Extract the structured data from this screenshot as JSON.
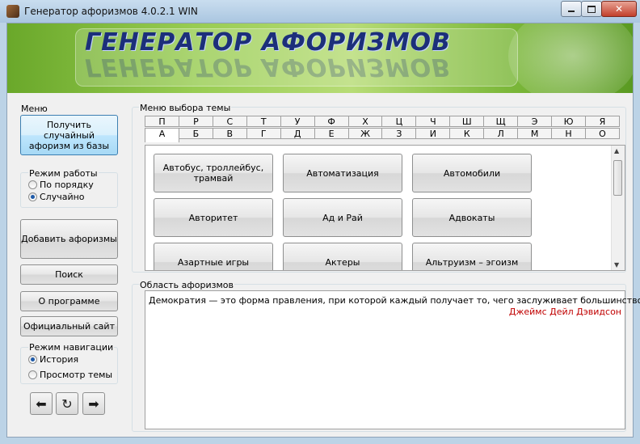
{
  "window": {
    "title": "Генератор афоризмов 4.0.2.1 WIN"
  },
  "banner": {
    "title": "ГЕНЕРАТОР АФОРИЗМОВ"
  },
  "sidebar": {
    "menu_label": "Меню",
    "random_button": "Получить случайный афоризм из базы",
    "mode": {
      "label": "Режим работы",
      "options": [
        "По порядку",
        "Случайно"
      ],
      "selected": "Случайно"
    },
    "add_button": "Добавить афоризмы",
    "search_button": "Поиск",
    "about_button": "О программе",
    "site_button": "Официальный сайт",
    "nav_mode": {
      "label": "Режим навигации",
      "options": [
        "История",
        "Просмотр темы"
      ],
      "selected": "История"
    },
    "nav_buttons": {
      "back": "back-arrow-icon",
      "refresh": "refresh-icon",
      "forward": "forward-arrow-icon"
    }
  },
  "topic_menu": {
    "label": "Меню выбора темы",
    "letters_row1": [
      "П",
      "Р",
      "С",
      "Т",
      "У",
      "Ф",
      "Х",
      "Ц",
      "Ч",
      "Ш",
      "Щ",
      "Э",
      "Ю",
      "Я"
    ],
    "letters_row2": [
      "А",
      "Б",
      "В",
      "Г",
      "Д",
      "Е",
      "Ж",
      "З",
      "И",
      "К",
      "Л",
      "М",
      "Н",
      "О"
    ],
    "active_letter": "А",
    "topics": [
      "Автобус, троллейбус, трамвай",
      "Автоматизация",
      "Автомобили",
      "Авторитет",
      "Ад и Рай",
      "Адвокаты",
      "Азартные игры",
      "Актеры",
      "Альтруизм – эгоизм"
    ]
  },
  "aphorism_area": {
    "label": "Область афоризмов",
    "text": "Демократия — это форма правления, при которой каждый получает то, чего заслуживает большинство.",
    "author": "Джеймс Дейл Дэвидсон",
    "author_color": "#c00000"
  }
}
